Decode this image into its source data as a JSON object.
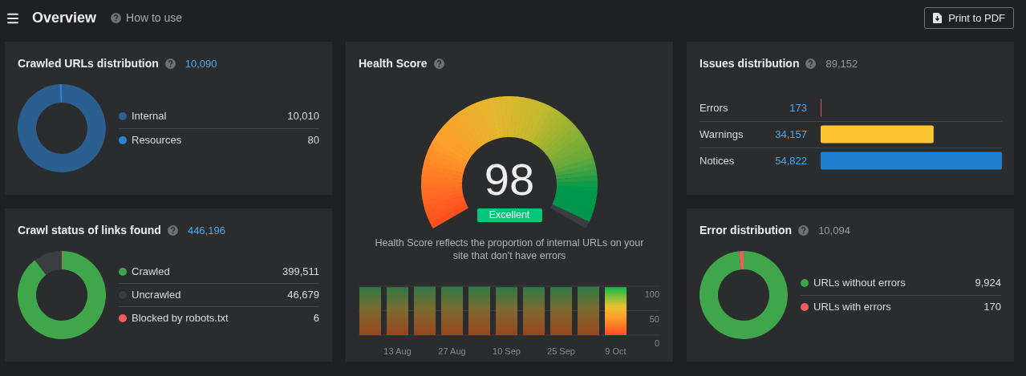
{
  "header": {
    "title": "Overview",
    "help_link": "How to use",
    "print_button": "Print to PDF"
  },
  "crawled_urls": {
    "title": "Crawled URLs distribution",
    "total": "10,090",
    "slices": [
      {
        "color": "#2a5f8f"
      },
      {
        "color": "#2a84d2"
      }
    ],
    "chart_data": {
      "type": "donut",
      "categories": [
        "Internal",
        "Resources"
      ],
      "values": [
        10010,
        80
      ],
      "value_labels": [
        "10,010",
        "80"
      ],
      "legend": true
    }
  },
  "crawl_status": {
    "title": "Crawl status of links found",
    "total": "446,196",
    "slices": [
      {
        "color": "#3fa64b"
      },
      {
        "color": "#3c3d40"
      },
      {
        "color": "#f25c5c"
      }
    ],
    "chart_data": {
      "type": "donut",
      "categories": [
        "Crawled",
        "Uncrawled",
        "Blocked by robots.txt"
      ],
      "values": [
        399511,
        46679,
        6
      ],
      "value_labels": [
        "399,511",
        "46,679",
        "6"
      ],
      "legend": true
    }
  },
  "health": {
    "title": "Health Score",
    "score": "98",
    "level": 0.98,
    "rating": "Excellent",
    "description": "Health Score reflects the proportion of internal URLs on your site that don't have errors",
    "bars": [
      {
        "selected": false
      },
      {
        "selected": false
      },
      {
        "selected": false
      },
      {
        "selected": false
      },
      {
        "selected": false
      },
      {
        "selected": false
      },
      {
        "selected": false
      },
      {
        "selected": false
      },
      {
        "selected": false
      },
      {
        "selected": true
      }
    ],
    "chart_data": {
      "type": "bar",
      "categories": [
        null,
        "13 Aug",
        null,
        "27 Aug",
        null,
        "10 Sep",
        null,
        "25 Sep",
        null,
        "9 Oct"
      ],
      "values": [
        98,
        98,
        99,
        99,
        99,
        98,
        98,
        98,
        99,
        98
      ],
      "ylim": [
        0,
        100
      ],
      "yticks": [
        0,
        50,
        100
      ]
    }
  },
  "issues": {
    "title": "Issues distribution",
    "total": "89,152",
    "bars": [
      {
        "color": "#e25c5c"
      },
      {
        "color": "#fdc62f"
      },
      {
        "color": "#1f7fcf"
      }
    ],
    "chart_data": {
      "type": "bar",
      "orientation": "horizontal",
      "categories": [
        "Errors",
        "Warnings",
        "Notices"
      ],
      "values": [
        173,
        34157,
        54822
      ],
      "value_labels": [
        "173",
        "34,157",
        "54,822"
      ]
    }
  },
  "errors": {
    "title": "Error distribution",
    "total": "10,094",
    "slices": [
      {
        "color": "#3fa64b"
      },
      {
        "color": "#f25c5c"
      }
    ],
    "chart_data": {
      "type": "donut",
      "categories": [
        "URLs without errors",
        "URLs with errors"
      ],
      "values": [
        9924,
        170
      ],
      "value_labels": [
        "9,924",
        "170"
      ],
      "legend": true
    }
  }
}
